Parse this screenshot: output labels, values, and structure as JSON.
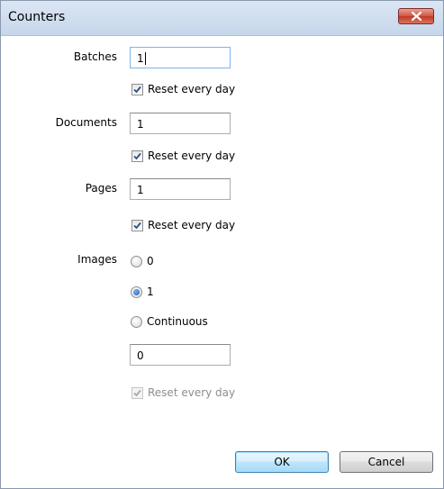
{
  "window": {
    "title": "Counters"
  },
  "batches": {
    "label": "Batches",
    "value": "1",
    "reset_label": "Reset every day",
    "reset_checked": true
  },
  "documents": {
    "label": "Documents",
    "value": "1",
    "reset_label": "Reset every day",
    "reset_checked": true
  },
  "pages": {
    "label": "Pages",
    "value": "1",
    "reset_label": "Reset every day",
    "reset_checked": true
  },
  "images": {
    "label": "Images",
    "options": [
      {
        "label": "0",
        "checked": false
      },
      {
        "label": "1",
        "checked": true
      },
      {
        "label": "Continuous",
        "checked": false
      }
    ],
    "value": "0",
    "reset_label": "Reset every day",
    "reset_checked": true,
    "reset_enabled": false
  },
  "buttons": {
    "ok_label": "OK",
    "cancel_label": "Cancel"
  },
  "icons": {
    "close": "close-icon",
    "check": "checkmark-icon"
  }
}
